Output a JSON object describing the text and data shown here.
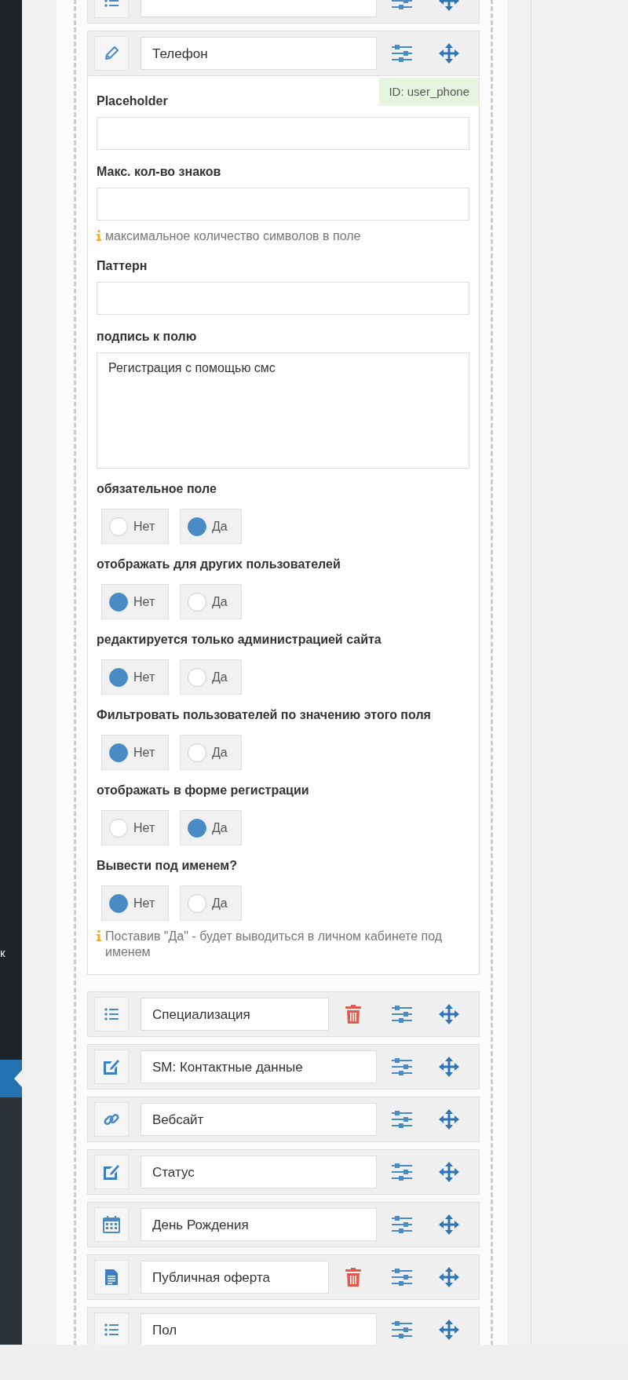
{
  "sidebar": {
    "items": [
      {
        "label": "к",
        "selected": false
      },
      {
        "selected": true
      }
    ]
  },
  "fields": [
    {
      "kind": "list",
      "deletable": false,
      "expanded": false
    },
    {
      "kind": "pencil",
      "name": "Телефон",
      "deletable": false,
      "expanded": true,
      "editor": {
        "id_badge": "ID: user_phone",
        "inputs": [
          {
            "kind": "text",
            "label": "Placeholder"
          },
          {
            "kind": "text",
            "label": "Макс. кол-во знаков",
            "hint": "максимальное количество символов в поле"
          },
          {
            "kind": "text",
            "label": "Паттерн"
          },
          {
            "kind": "textarea",
            "label": "подпись к полю",
            "value": "Регистрация с помощью смс"
          }
        ],
        "options": [
          {
            "label": "обязательное поле",
            "choices": [
              {
                "label": "Нет",
                "selected": false
              },
              {
                "label": "Да",
                "selected": true
              }
            ]
          },
          {
            "label": "отображать для других пользователей",
            "choices": [
              {
                "label": "Нет",
                "selected": true
              },
              {
                "label": "Да",
                "selected": false
              }
            ]
          },
          {
            "label": "редактируется только администрацией сайта",
            "choices": [
              {
                "label": "Нет",
                "selected": true
              },
              {
                "label": "Да",
                "selected": false
              }
            ]
          },
          {
            "label": "Фильтровать пользователей по значению этого поля",
            "choices": [
              {
                "label": "Нет",
                "selected": true
              },
              {
                "label": "Да",
                "selected": false
              }
            ]
          },
          {
            "label": "отображать в форме регистрации",
            "choices": [
              {
                "label": "Нет",
                "selected": false
              },
              {
                "label": "Да",
                "selected": true
              }
            ]
          },
          {
            "label": "Вывести под именем?",
            "choices": [
              {
                "label": "Нет",
                "selected": true
              },
              {
                "label": "Да",
                "selected": false
              }
            ],
            "hint": "Поставив \"Да\" - будет выводиться в личном кабинете под именем"
          }
        ]
      }
    },
    {
      "kind": "list",
      "name": "Специализация",
      "deletable": true,
      "expanded": false
    },
    {
      "kind": "note",
      "name": "SM: Контактные данные",
      "deletable": false,
      "expanded": false
    },
    {
      "kind": "link",
      "name": "Вебсайт",
      "deletable": false,
      "expanded": false
    },
    {
      "kind": "note",
      "name": "Статус",
      "deletable": false,
      "expanded": false
    },
    {
      "kind": "calendar",
      "name": "День Рождения",
      "deletable": false,
      "expanded": false
    },
    {
      "kind": "document",
      "name": "Публичная оферта",
      "deletable": true,
      "expanded": false
    },
    {
      "kind": "list",
      "name": "Пол",
      "deletable": false,
      "expanded": false
    }
  ]
}
